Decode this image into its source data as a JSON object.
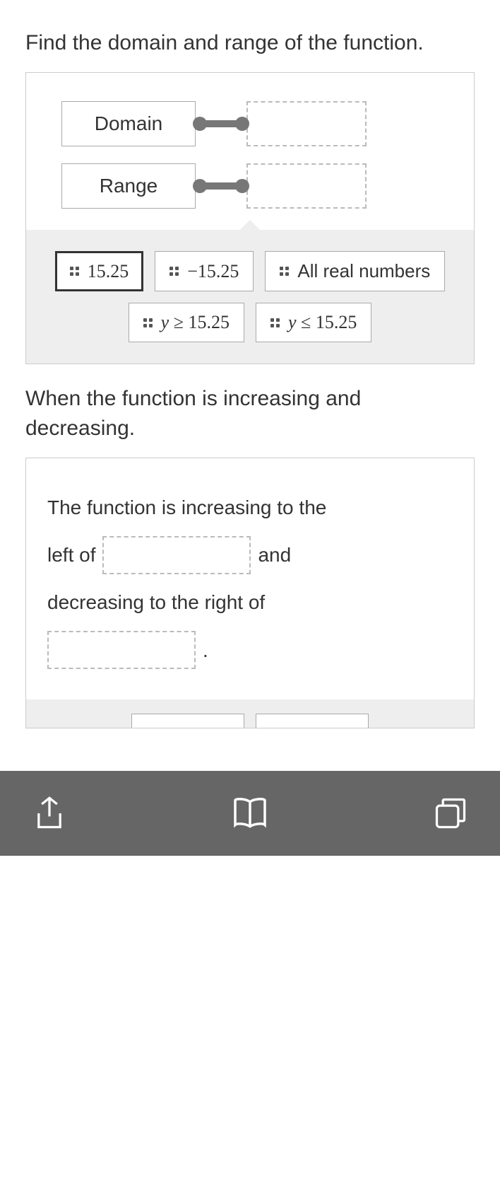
{
  "q1": {
    "prompt": "Find the domain and range of the function.",
    "labels": {
      "domain": "Domain",
      "range": "Range"
    },
    "options": {
      "a": "15.25",
      "b": "−15.25",
      "c": "All real numbers",
      "d": "y ≥ 15.25",
      "e": "y ≤ 15.25"
    }
  },
  "q2": {
    "prompt": "When the function is increasing and decreasing.",
    "text1": "The function is increasing to the",
    "text2": "left of",
    "text3": "and",
    "text4": "decreasing to the right of",
    "text5": "."
  }
}
